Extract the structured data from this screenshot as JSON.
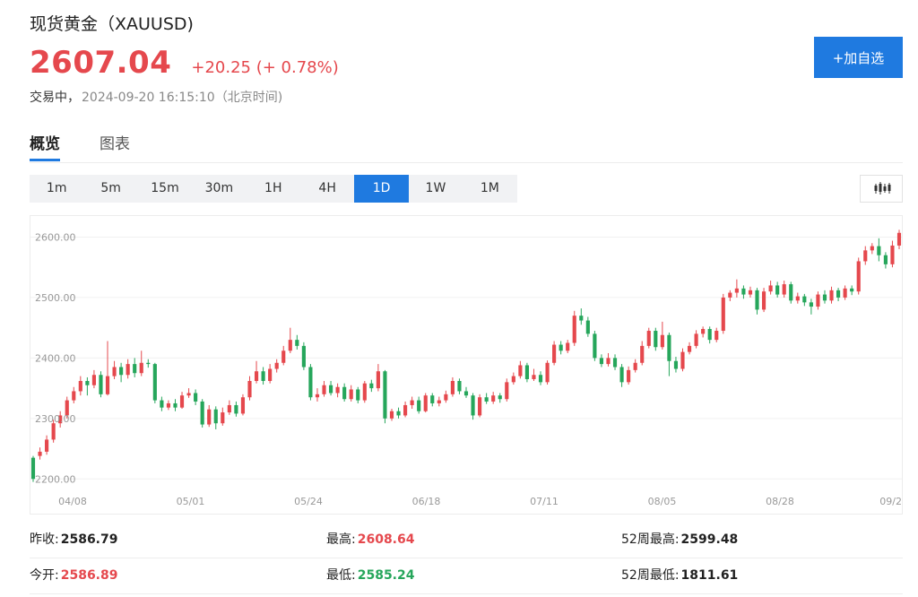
{
  "header": {
    "title": "现货黄金（XAUUSD)",
    "price": "2607.04",
    "change": "+20.25 (+ 0.78%)",
    "status": "交易中，",
    "timestamp": "2024-09-20 16:15:10（北京时间)",
    "add_button": "+加自选"
  },
  "tabs": [
    {
      "label": "概览",
      "active": true
    },
    {
      "label": "图表",
      "active": false
    }
  ],
  "periods": [
    {
      "label": "1m"
    },
    {
      "label": "5m"
    },
    {
      "label": "15m"
    },
    {
      "label": "30m"
    },
    {
      "label": "1H"
    },
    {
      "label": "4H"
    },
    {
      "label": "1D",
      "active": true
    },
    {
      "label": "1W"
    },
    {
      "label": "1M"
    }
  ],
  "chart_type_icon": "candlestick-icon",
  "colors": {
    "up": "#e5484d",
    "down": "#26a65b",
    "accent": "#1f7ae0"
  },
  "chart_data": {
    "type": "candlestick",
    "ylim": [
      2190,
      2620
    ],
    "y_ticks": [
      "2200.00",
      "2300.00",
      "2400.00",
      "2500.00",
      "2600.00"
    ],
    "x_ticks": [
      "04/08",
      "05/01",
      "05/24",
      "06/18",
      "07/11",
      "08/05",
      "08/28",
      "09/2"
    ],
    "grid": true,
    "candles": [
      [
        2235,
        2200,
        2238,
        2195
      ],
      [
        2238,
        2245,
        2252,
        2232
      ],
      [
        2245,
        2265,
        2272,
        2240
      ],
      [
        2265,
        2292,
        2298,
        2260
      ],
      [
        2292,
        2305,
        2312,
        2285
      ],
      [
        2305,
        2330,
        2336,
        2300
      ],
      [
        2330,
        2345,
        2352,
        2325
      ],
      [
        2345,
        2362,
        2370,
        2338
      ],
      [
        2362,
        2355,
        2368,
        2338
      ],
      [
        2355,
        2372,
        2380,
        2350
      ],
      [
        2372,
        2340,
        2378,
        2335
      ],
      [
        2340,
        2370,
        2428,
        2338
      ],
      [
        2370,
        2385,
        2395,
        2365
      ],
      [
        2385,
        2372,
        2392,
        2360
      ],
      [
        2372,
        2390,
        2398,
        2366
      ],
      [
        2390,
        2375,
        2400,
        2368
      ],
      [
        2375,
        2392,
        2412,
        2370
      ],
      [
        2392,
        2390,
        2398,
        2384
      ],
      [
        2390,
        2330,
        2392,
        2325
      ],
      [
        2330,
        2318,
        2336,
        2312
      ],
      [
        2318,
        2325,
        2330,
        2314
      ],
      [
        2325,
        2318,
        2332,
        2312
      ],
      [
        2318,
        2338,
        2344,
        2316
      ],
      [
        2338,
        2342,
        2350,
        2334
      ],
      [
        2342,
        2328,
        2348,
        2322
      ],
      [
        2328,
        2290,
        2332,
        2285
      ],
      [
        2290,
        2315,
        2322,
        2286
      ],
      [
        2315,
        2292,
        2320,
        2282
      ],
      [
        2292,
        2310,
        2318,
        2288
      ],
      [
        2310,
        2322,
        2330,
        2306
      ],
      [
        2322,
        2308,
        2328,
        2303
      ],
      [
        2308,
        2335,
        2340,
        2305
      ],
      [
        2335,
        2362,
        2370,
        2330
      ],
      [
        2362,
        2378,
        2395,
        2358
      ],
      [
        2378,
        2362,
        2385,
        2356
      ],
      [
        2362,
        2382,
        2390,
        2358
      ],
      [
        2382,
        2392,
        2398,
        2376
      ],
      [
        2392,
        2412,
        2420,
        2388
      ],
      [
        2412,
        2430,
        2450,
        2408
      ],
      [
        2430,
        2420,
        2438,
        2414
      ],
      [
        2420,
        2385,
        2426,
        2380
      ],
      [
        2385,
        2335,
        2390,
        2330
      ],
      [
        2335,
        2340,
        2350,
        2328
      ],
      [
        2340,
        2355,
        2362,
        2336
      ],
      [
        2355,
        2342,
        2362,
        2338
      ],
      [
        2342,
        2352,
        2358,
        2335
      ],
      [
        2352,
        2332,
        2358,
        2328
      ],
      [
        2332,
        2348,
        2355,
        2328
      ],
      [
        2348,
        2330,
        2352,
        2325
      ],
      [
        2330,
        2358,
        2362,
        2326
      ],
      [
        2358,
        2350,
        2364,
        2344
      ],
      [
        2350,
        2378,
        2390,
        2345
      ],
      [
        2378,
        2300,
        2380,
        2292
      ],
      [
        2300,
        2312,
        2316,
        2296
      ],
      [
        2312,
        2305,
        2318,
        2300
      ],
      [
        2305,
        2322,
        2328,
        2302
      ],
      [
        2322,
        2330,
        2336,
        2316
      ],
      [
        2330,
        2312,
        2336,
        2308
      ],
      [
        2312,
        2338,
        2342,
        2310
      ],
      [
        2338,
        2325,
        2342,
        2320
      ],
      [
        2325,
        2330,
        2336,
        2320
      ],
      [
        2330,
        2340,
        2346,
        2326
      ],
      [
        2340,
        2362,
        2368,
        2336
      ],
      [
        2362,
        2345,
        2366,
        2340
      ],
      [
        2345,
        2338,
        2352,
        2334
      ],
      [
        2338,
        2305,
        2342,
        2298
      ],
      [
        2305,
        2335,
        2340,
        2302
      ],
      [
        2335,
        2328,
        2342,
        2324
      ],
      [
        2328,
        2338,
        2344,
        2324
      ],
      [
        2338,
        2332,
        2342,
        2326
      ],
      [
        2332,
        2360,
        2366,
        2328
      ],
      [
        2360,
        2370,
        2376,
        2356
      ],
      [
        2370,
        2388,
        2395,
        2366
      ],
      [
        2388,
        2365,
        2392,
        2360
      ],
      [
        2365,
        2372,
        2382,
        2362
      ],
      [
        2372,
        2360,
        2378,
        2355
      ],
      [
        2360,
        2392,
        2396,
        2356
      ],
      [
        2392,
        2422,
        2428,
        2388
      ],
      [
        2422,
        2412,
        2428,
        2406
      ],
      [
        2412,
        2425,
        2430,
        2408
      ],
      [
        2425,
        2470,
        2478,
        2420
      ],
      [
        2470,
        2462,
        2482,
        2455
      ],
      [
        2462,
        2440,
        2468,
        2435
      ],
      [
        2440,
        2400,
        2445,
        2395
      ],
      [
        2400,
        2390,
        2406,
        2385
      ],
      [
        2390,
        2400,
        2408,
        2386
      ],
      [
        2400,
        2385,
        2406,
        2380
      ],
      [
        2385,
        2360,
        2390,
        2352
      ],
      [
        2360,
        2380,
        2386,
        2356
      ],
      [
        2380,
        2392,
        2398,
        2376
      ],
      [
        2392,
        2420,
        2428,
        2388
      ],
      [
        2420,
        2445,
        2450,
        2416
      ],
      [
        2445,
        2418,
        2450,
        2412
      ],
      [
        2418,
        2438,
        2460,
        2414
      ],
      [
        2438,
        2395,
        2442,
        2370
      ],
      [
        2395,
        2382,
        2402,
        2376
      ],
      [
        2382,
        2410,
        2416,
        2378
      ],
      [
        2410,
        2420,
        2426,
        2406
      ],
      [
        2420,
        2440,
        2446,
        2416
      ],
      [
        2440,
        2448,
        2452,
        2434
      ],
      [
        2448,
        2430,
        2452,
        2424
      ],
      [
        2430,
        2445,
        2450,
        2426
      ],
      [
        2445,
        2500,
        2506,
        2440
      ],
      [
        2500,
        2508,
        2512,
        2494
      ],
      [
        2508,
        2515,
        2530,
        2500
      ],
      [
        2515,
        2505,
        2520,
        2498
      ],
      [
        2505,
        2512,
        2518,
        2500
      ],
      [
        2512,
        2480,
        2516,
        2472
      ],
      [
        2480,
        2510,
        2516,
        2476
      ],
      [
        2510,
        2520,
        2528,
        2505
      ],
      [
        2520,
        2505,
        2526,
        2500
      ],
      [
        2505,
        2522,
        2528,
        2500
      ],
      [
        2522,
        2495,
        2526,
        2490
      ],
      [
        2495,
        2502,
        2508,
        2490
      ],
      [
        2502,
        2492,
        2506,
        2486
      ],
      [
        2492,
        2485,
        2498,
        2472
      ],
      [
        2485,
        2505,
        2510,
        2480
      ],
      [
        2505,
        2495,
        2512,
        2490
      ],
      [
        2495,
        2512,
        2518,
        2490
      ],
      [
        2512,
        2500,
        2516,
        2494
      ],
      [
        2500,
        2515,
        2520,
        2496
      ],
      [
        2515,
        2510,
        2520,
        2504
      ],
      [
        2510,
        2560,
        2566,
        2505
      ],
      [
        2560,
        2578,
        2585,
        2554
      ],
      [
        2578,
        2585,
        2590,
        2572
      ],
      [
        2585,
        2570,
        2598,
        2560
      ],
      [
        2570,
        2555,
        2575,
        2548
      ],
      [
        2555,
        2586,
        2594,
        2550
      ],
      [
        2586,
        2607,
        2612,
        2580
      ]
    ]
  },
  "stats": [
    [
      {
        "label": "昨收:",
        "value": "2586.79",
        "color": "default"
      },
      {
        "label": "最高:",
        "value": "2608.64",
        "color": "red"
      },
      {
        "label": "52周最高:",
        "value": "2599.48",
        "color": "default"
      }
    ],
    [
      {
        "label": "今开:",
        "value": "2586.89",
        "color": "red"
      },
      {
        "label": "最低:",
        "value": "2585.24",
        "color": "green"
      },
      {
        "label": "52周最低:",
        "value": "1811.61",
        "color": "default"
      }
    ]
  ]
}
